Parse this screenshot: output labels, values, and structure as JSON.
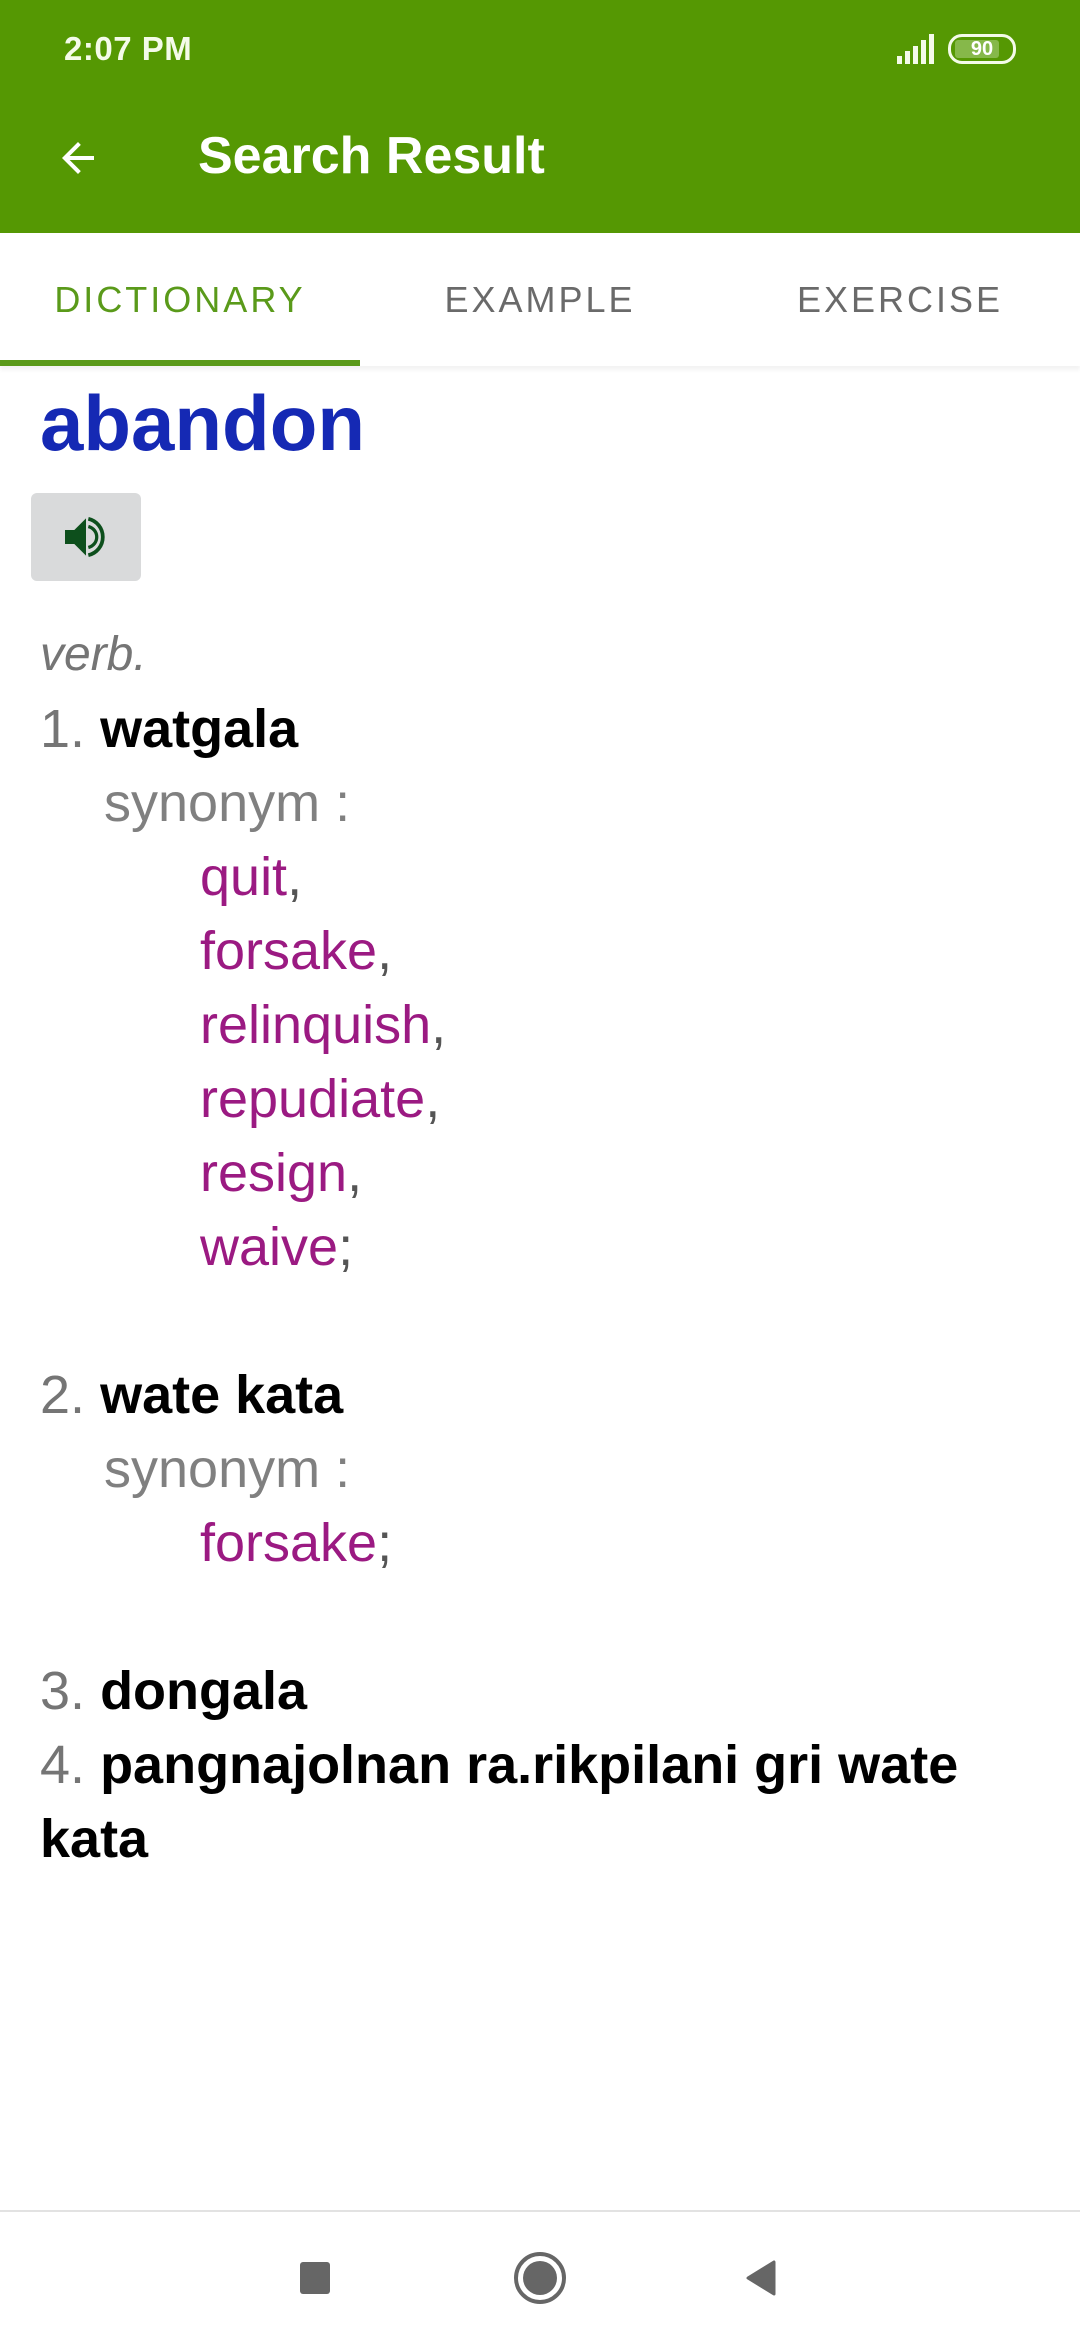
{
  "status_bar": {
    "time": "2:07 PM",
    "battery_level": "90",
    "signal_icon": "signal-icon",
    "battery_icon": "battery-icon"
  },
  "header": {
    "title": "Search Result",
    "back_icon": "arrow-back-icon"
  },
  "tabs": [
    {
      "label": "DICTIONARY",
      "active": true
    },
    {
      "label": "EXAMPLE",
      "active": false
    },
    {
      "label": "EXERCISE",
      "active": false
    }
  ],
  "entry": {
    "word": "abandon",
    "speak_icon": "speaker-icon",
    "part_of_speech": "verb.",
    "senses": [
      {
        "number": "1.",
        "definition": "watgala",
        "synonym_label": "synonym :",
        "synonyms": [
          {
            "word": "quit",
            "punct": ","
          },
          {
            "word": "forsake",
            "punct": ","
          },
          {
            "word": "relinquish",
            "punct": ","
          },
          {
            "word": "repudiate",
            "punct": ","
          },
          {
            "word": "resign",
            "punct": ","
          },
          {
            "word": "waive",
            "punct": ";"
          }
        ]
      },
      {
        "number": "2.",
        "definition": "wate kata",
        "synonym_label": "synonym :",
        "synonyms": [
          {
            "word": "forsake",
            "punct": ";"
          }
        ]
      },
      {
        "number": "3.",
        "definition": "dongala"
      },
      {
        "number": "4.",
        "definition": "pangnajolnan ra.rikpilani gri wate kata"
      }
    ]
  },
  "colors": {
    "accent": "#559803",
    "tab_active": "#5a9a1a",
    "headword": "#1529b4",
    "synonym": "#9b1a82"
  },
  "nav_bar": {
    "recents_icon": "recents-square-icon",
    "home_icon": "home-circle-icon",
    "back_icon": "back-triangle-icon"
  }
}
